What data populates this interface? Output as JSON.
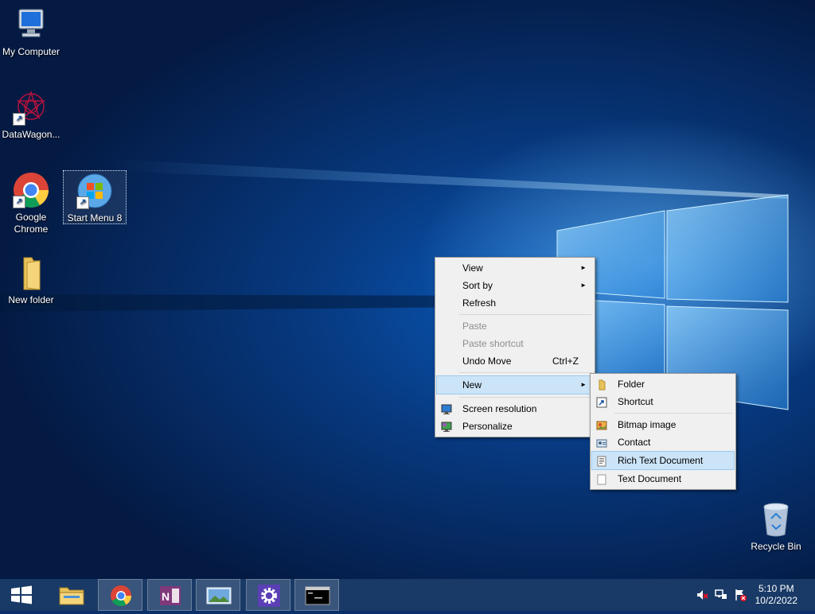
{
  "desktop": {
    "icons": [
      {
        "label": "My Computer"
      },
      {
        "label": "DataWagon..."
      },
      {
        "label": "Google Chrome"
      },
      {
        "label": "Start Menu 8"
      },
      {
        "label": "New folder"
      },
      {
        "label": "Recycle Bin"
      }
    ]
  },
  "context_menu": {
    "items": [
      {
        "label": "View"
      },
      {
        "label": "Sort by"
      },
      {
        "label": "Refresh"
      },
      {
        "label": "Paste"
      },
      {
        "label": "Paste shortcut"
      },
      {
        "label": "Undo Move",
        "shortcut": "Ctrl+Z"
      },
      {
        "label": "New"
      },
      {
        "label": "Screen resolution"
      },
      {
        "label": "Personalize"
      }
    ]
  },
  "new_submenu": {
    "items": [
      {
        "label": "Folder"
      },
      {
        "label": "Shortcut"
      },
      {
        "label": "Bitmap image"
      },
      {
        "label": "Contact"
      },
      {
        "label": "Rich Text Document"
      },
      {
        "label": "Text Document"
      }
    ]
  },
  "taskbar": {
    "clock_time": "5:10 PM",
    "clock_date": "10/2/2022"
  },
  "colors": {
    "accent": "#0a5bbd",
    "taskbar": "#193a66",
    "menu_highlight": "#cce4f7"
  }
}
